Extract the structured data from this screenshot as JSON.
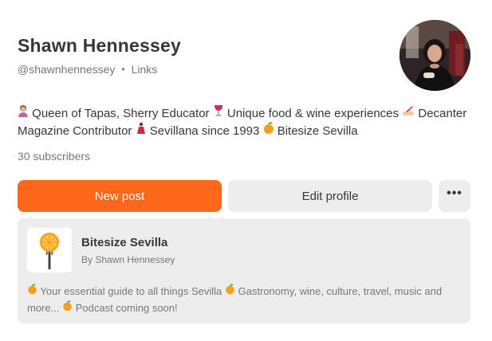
{
  "profile": {
    "name": "Shawn Hennessey",
    "handle": "@shawnhennessey",
    "links_label": "Links",
    "bio": {
      "segment1": "Queen of Tapas, Sherry Educator",
      "segment2": "Unique food & wine experiences",
      "segment3": "Decanter Magazine Contributor",
      "segment4": "Sevillana since 1993",
      "segment5": "Bitesize Sevilla"
    },
    "subscribers": "30 subscribers",
    "avatar_icon": "profile-photo"
  },
  "actions": {
    "new_post_label": "New post",
    "edit_profile_label": "Edit profile",
    "more_label": "•••"
  },
  "publication": {
    "title": "Bitesize Sevilla",
    "author": "By Shawn Hennessey",
    "desc1": "Your essential guide to all things Sevilla",
    "desc2": "Gastronomy, wine, culture, travel, music and more...",
    "desc3": "Podcast coming soon!",
    "logo_icon": "orange-slice-fork-icon"
  },
  "colors": {
    "accent": "#ff6719",
    "button_secondary": "#ededed",
    "card_bg": "#ededed",
    "text_primary": "#363737",
    "text_muted": "#777777"
  }
}
